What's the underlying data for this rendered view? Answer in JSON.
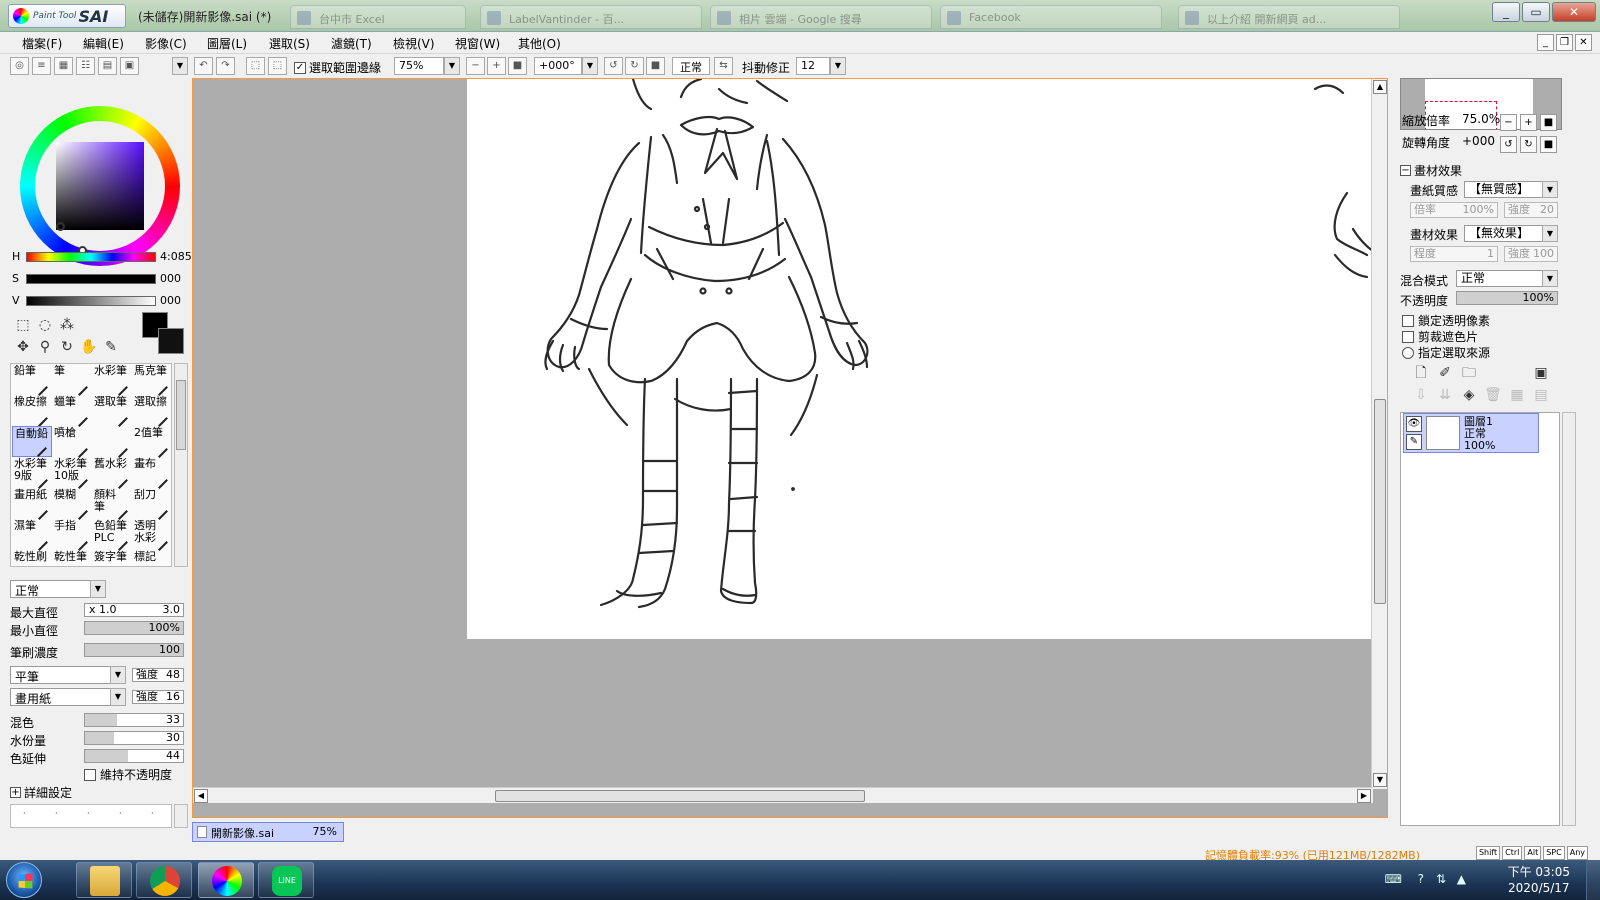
{
  "titlebar": {
    "app_logo_small": "Paint Tool",
    "app_logo_big": "SAI",
    "document_title": "(未儲存)開新影像.sai (*)",
    "ghost_tabs": [
      "台中市 Excel",
      "LabelVantinder - 百...",
      "相片 雲端 - Google 搜尋",
      "Facebook",
      "以上介紹 開新網頁 ad..."
    ]
  },
  "menu": [
    "檔案(F)",
    "編輯(E)",
    "影像(C)",
    "圖層(L)",
    "選取(S)",
    "濾鏡(T)",
    "檢視(V)",
    "視窗(W)",
    "其他(O)"
  ],
  "toolbar": {
    "checkbox_label": "選取範圍邊緣",
    "checkbox_checked": true,
    "zoom": "75%",
    "angle": "+000°",
    "blend": "正常",
    "stabilizer_label": "抖動修正",
    "stabilizer_value": "12"
  },
  "color_panel": {
    "h_label": "H",
    "h_value": "4:085",
    "s_label": "S",
    "s_value": "000",
    "v_label": "V",
    "v_value": "000",
    "main_color": "#000000"
  },
  "brushes": [
    [
      "鉛筆",
      "筆",
      "水彩筆",
      "馬克筆"
    ],
    [
      "橡皮擦",
      "蠟筆",
      "選取筆",
      "選取擦"
    ],
    [
      "自動鉛",
      "噴槍",
      "",
      "2值筆"
    ],
    [
      "水彩筆 9版",
      "水彩筆 10版",
      "舊水彩",
      "畫布"
    ],
    [
      "畫用紙",
      "模糊",
      "顏料 筆",
      "刮刀"
    ],
    [
      "濕筆",
      "手指",
      "色鉛筆 PLC",
      "透明 水彩"
    ],
    [
      "乾性刷",
      "乾性筆",
      "簽字筆",
      "標記"
    ]
  ],
  "brush_props": {
    "mode": "正常",
    "max_size_label": "最大直徑",
    "max_size_mult": "x 1.0",
    "max_size_value": "3.0",
    "min_size_label": "最小直徑",
    "min_size_value": "100%",
    "density_label": "筆刷濃度",
    "density_value": "100",
    "shape": "平筆",
    "shape_strength_label": "強度",
    "shape_strength": "48",
    "texture": "畫用紙",
    "texture_strength_label": "強度",
    "texture_strength": "16",
    "blending_label": "混色",
    "blending_value": "33",
    "dilution_label": "水份量",
    "dilution_value": "30",
    "persistence_label": "色延伸",
    "persistence_value": "44",
    "keep_opacity_label": "維持不透明度",
    "detail_label": "詳細設定"
  },
  "doc_tab": {
    "name": "開新影像.sai",
    "zoom": "75%"
  },
  "navigator": {
    "zoom_label": "縮放倍率",
    "zoom_value": "75.0%",
    "angle_label": "旋轉角度",
    "angle_value": "+000"
  },
  "layer_props": {
    "section_label": "畫材效果",
    "paper_label": "畫紙質感",
    "paper_value": "【無質感】",
    "paper_scale_label": "倍率",
    "paper_scale": "100%",
    "paper_strength_label": "強度",
    "paper_strength": "20",
    "effect_label": "畫材效果",
    "effect_value": "【無效果】",
    "effect_degree_label": "程度",
    "effect_degree": "1",
    "effect_strength_label": "強度",
    "effect_strength": "100",
    "blend_label": "混合模式",
    "blend_value": "正常",
    "opacity_label": "不透明度",
    "opacity_value": "100%",
    "lock_label": "鎖定透明像素",
    "clip_label": "剪裁遮色片",
    "source_label": "指定選取來源"
  },
  "layer": {
    "name": "圖層1",
    "mode": "正常",
    "opacity": "100%"
  },
  "status": {
    "memory": "記憶體負載率:93% (已用121MB/1282MB)",
    "keys": [
      "Shift",
      "Ctrl",
      "Alt",
      "SPC",
      "Any"
    ]
  },
  "taskbar": {
    "time": "下午 03:05",
    "date": "2020/5/17"
  }
}
